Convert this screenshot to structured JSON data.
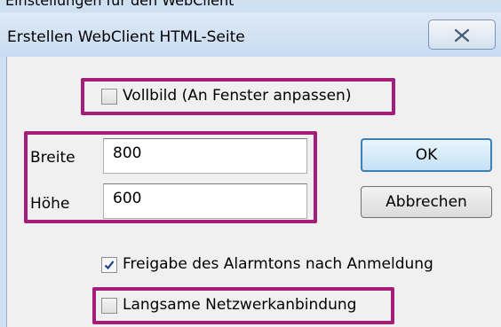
{
  "top_caption": "Einstellungen für den WebClient",
  "window": {
    "title": "Erstellen WebClient HTML-Seite",
    "close_icon": "close-x-icon"
  },
  "fullscreen": {
    "label": "Vollbild (An Fenster anpassen)",
    "checked": false
  },
  "size": {
    "width_label": "Breite",
    "width_value": "800",
    "height_label": "Höhe",
    "height_value": "600"
  },
  "buttons": {
    "ok": "OK",
    "cancel": "Abbrechen"
  },
  "alarm_release": {
    "label": "Freigabe des Alarmtons nach Anmeldung",
    "checked": true
  },
  "slow_network": {
    "label": "Langsame Netzwerkanbindung",
    "checked": false
  },
  "colors": {
    "highlight": "#a31d79",
    "default_button_border": "#3c7fb1",
    "checkmark": "#1e3f86"
  }
}
